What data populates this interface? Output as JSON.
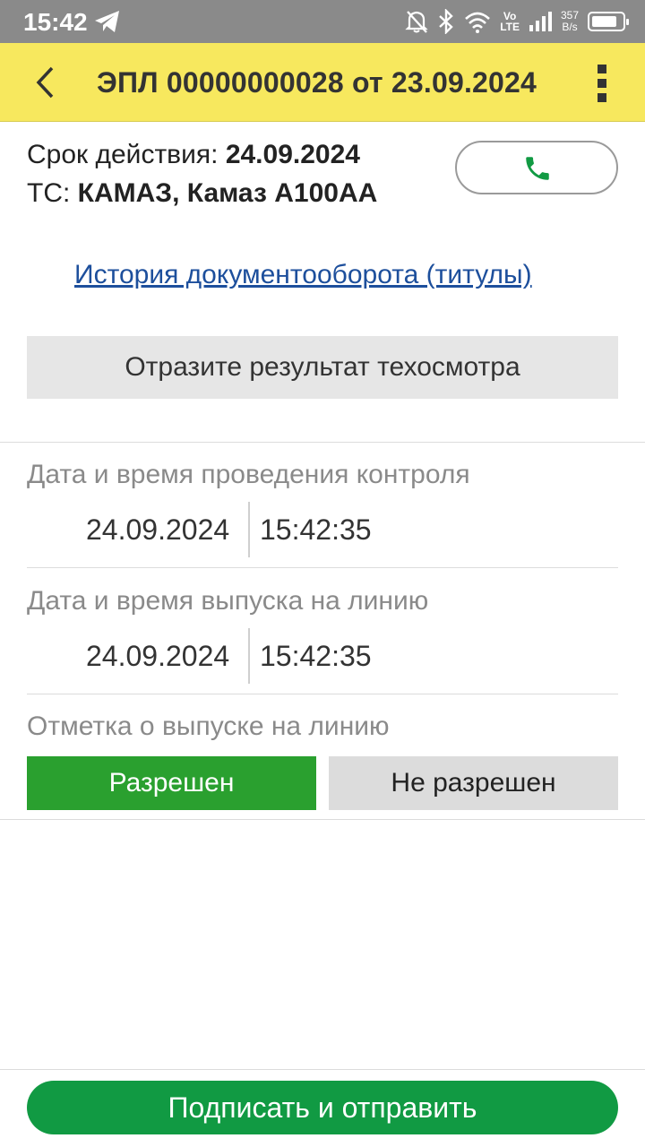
{
  "status_bar": {
    "time": "15:42",
    "network_top": "Vo",
    "network_bottom": "LTE",
    "speed_value": "357",
    "speed_unit": "B/s",
    "battery_level": 0.85
  },
  "header": {
    "title": "ЭПЛ 00000000028 от 23.09.2024",
    "background_color": "#f7e85e"
  },
  "info": {
    "validity_label": "Срок действия:",
    "validity_value": "24.09.2024",
    "vehicle_label": "ТС:",
    "vehicle_value": "КАМАЗ, Камаз А100АА"
  },
  "history_link": "История документооборота (титулы)",
  "inspection_button": "Отразите результат техосмотра",
  "control": {
    "label": "Дата и время проведения контроля",
    "date": "24.09.2024",
    "time": "15:42:35"
  },
  "release": {
    "label": "Дата и время выпуска на линию",
    "date": "24.09.2024",
    "time": "15:42:35"
  },
  "release_mark": {
    "label": "Отметка о выпуске на линию",
    "allowed": "Разрешен",
    "denied": "Не разрешен",
    "selected": "Разрешен"
  },
  "sign_button": "Подписать и отправить",
  "colors": {
    "accent_green": "#2aa02f",
    "sign_green": "#119a43",
    "link_blue": "#1d4f9c"
  },
  "icons": [
    "back-arrow-icon",
    "more-vert-icon",
    "phone-icon",
    "telegram-icon",
    "bell-off-icon",
    "bluetooth-icon",
    "wifi-icon",
    "signal-icon",
    "battery-icon"
  ]
}
